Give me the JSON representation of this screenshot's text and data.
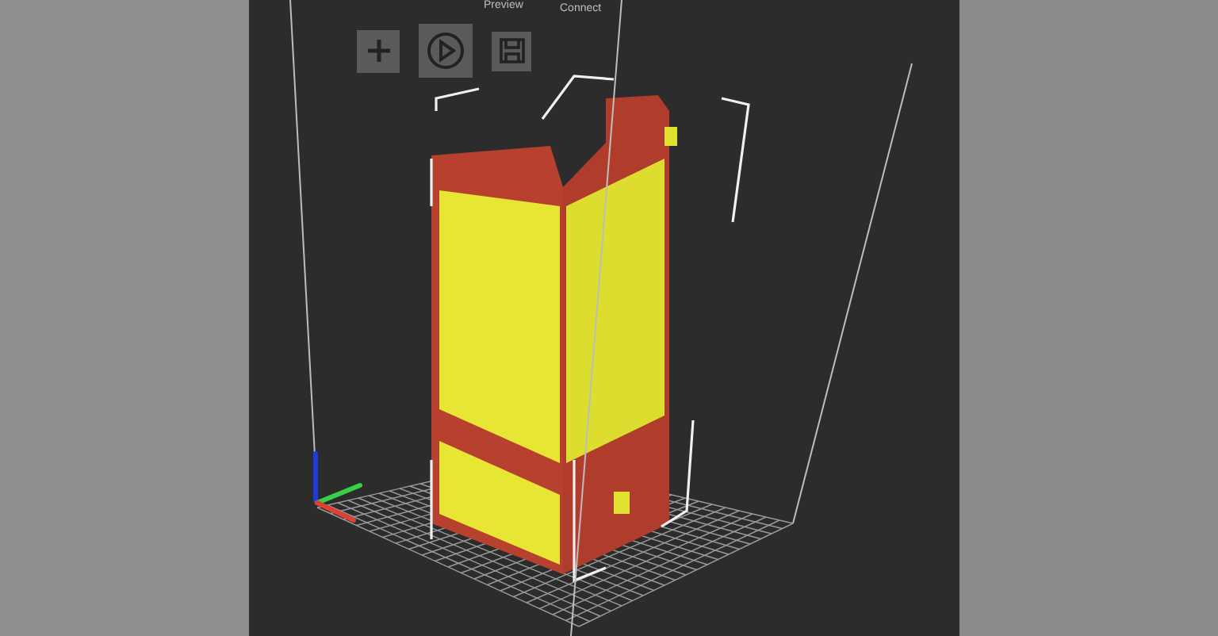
{
  "toolbar": {
    "buttons": [
      {
        "kind": "add"
      },
      {
        "kind": "play"
      },
      {
        "kind": "save"
      }
    ],
    "labels": [
      {
        "text": "Preview"
      },
      {
        "text": "Connect"
      }
    ]
  }
}
